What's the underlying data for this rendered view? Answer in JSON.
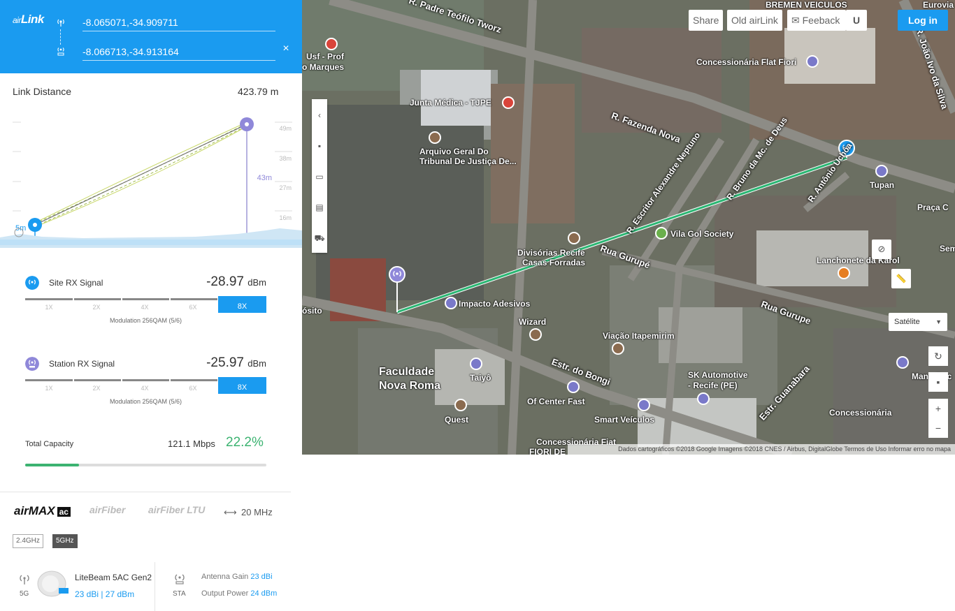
{
  "header": {
    "logo_prefix": "air",
    "logo_main": "Link",
    "coord1": "-8.065071,-34.909711",
    "coord2": "-8.066713,-34.913164",
    "clear_label": "×"
  },
  "link": {
    "distance_label": "Link Distance",
    "distance_value": "423.79 m"
  },
  "profile": {
    "height_labels": [
      "49m",
      "38m",
      "27m",
      "16m"
    ],
    "tower_height": "43m",
    "site_height": "5m"
  },
  "site_signal": {
    "label": "Site RX Signal",
    "value": "-28.97",
    "unit": "dBm",
    "ticks": [
      "1X",
      "2X",
      "4X",
      "6X"
    ],
    "active": "8X",
    "modulation": "Modulation 256QAM (5/6)"
  },
  "station_signal": {
    "label": "Station RX Signal",
    "value": "-25.97",
    "unit": "dBm",
    "ticks": [
      "1X",
      "2X",
      "4X",
      "6X"
    ],
    "active": "8X",
    "modulation": "Modulation 256QAM (5/6)"
  },
  "capacity": {
    "label": "Total Capacity",
    "value": "121.1 Mbps",
    "percent": "22.2%"
  },
  "products": {
    "airmax": "airMAX",
    "airmax_ac": "ac",
    "airfiber": "airFiber",
    "airfiber_ltu": "airFiber LTU",
    "bandwidth": "20 MHz"
  },
  "bands": {
    "band_24": "2.4GHz",
    "band_5": "5GHz"
  },
  "device": {
    "band_label": "5G",
    "name": "LiteBeam 5AC Gen2",
    "specs": "23 dBi | 27 dBm",
    "mode": "STA",
    "antenna_gain_label": "Antenna Gain",
    "antenna_gain_value": "23 dBi",
    "output_power_label": "Output Power",
    "output_power_value": "24 dBm"
  },
  "map": {
    "buttons": {
      "share": "Share",
      "old_airlink": "Old airLink",
      "feedback": "Feeback",
      "login": "Log in"
    },
    "map_type": "Satélite",
    "attribution": "Dados cartográficos ©2018 Google Imagens ©2018 CNES / Airbus, DigitalGlobe   Termos de Uso   Informar erro no mapa",
    "labels": [
      "BREMEN VEICULOS",
      "R. Padre Teófilo Tworz",
      "R. João Ivo da Silva",
      "Eurovia",
      "Concessionária Flat Fiori",
      "Usf - Prof",
      "o Marques",
      "Junta Médica - TJPE",
      "Arquivo Geral Do",
      "Tribunal De Justiça De...",
      "R. Fazenda Nova",
      "R. Escritor Alexandre Neptuno",
      "R. Bruno da Mc. de Deus",
      "R. Antônio Uchôa",
      "Tupan",
      "Praça C",
      "Vila Gol Society",
      "Divisórias Recife",
      "Casas Forradas",
      "Rua Gurupé",
      "Lanchonete da Karol",
      "Impacto Adesivos",
      "Wizard",
      "Viação Itapemirim",
      "Rua Gurupe",
      "Faculdade",
      "Nova Roma",
      "Taiyô",
      "Estr. do Bongi",
      "Of Center Fast",
      "Smart Veículos",
      "SK Automotive",
      "- Recife (PE)",
      "Concessionária",
      "Mano Roc",
      "Quest",
      "Concessionária Fiat",
      "FIORI DE",
      "Estr. Guanabara",
      "Sem",
      "ósito"
    ]
  }
}
